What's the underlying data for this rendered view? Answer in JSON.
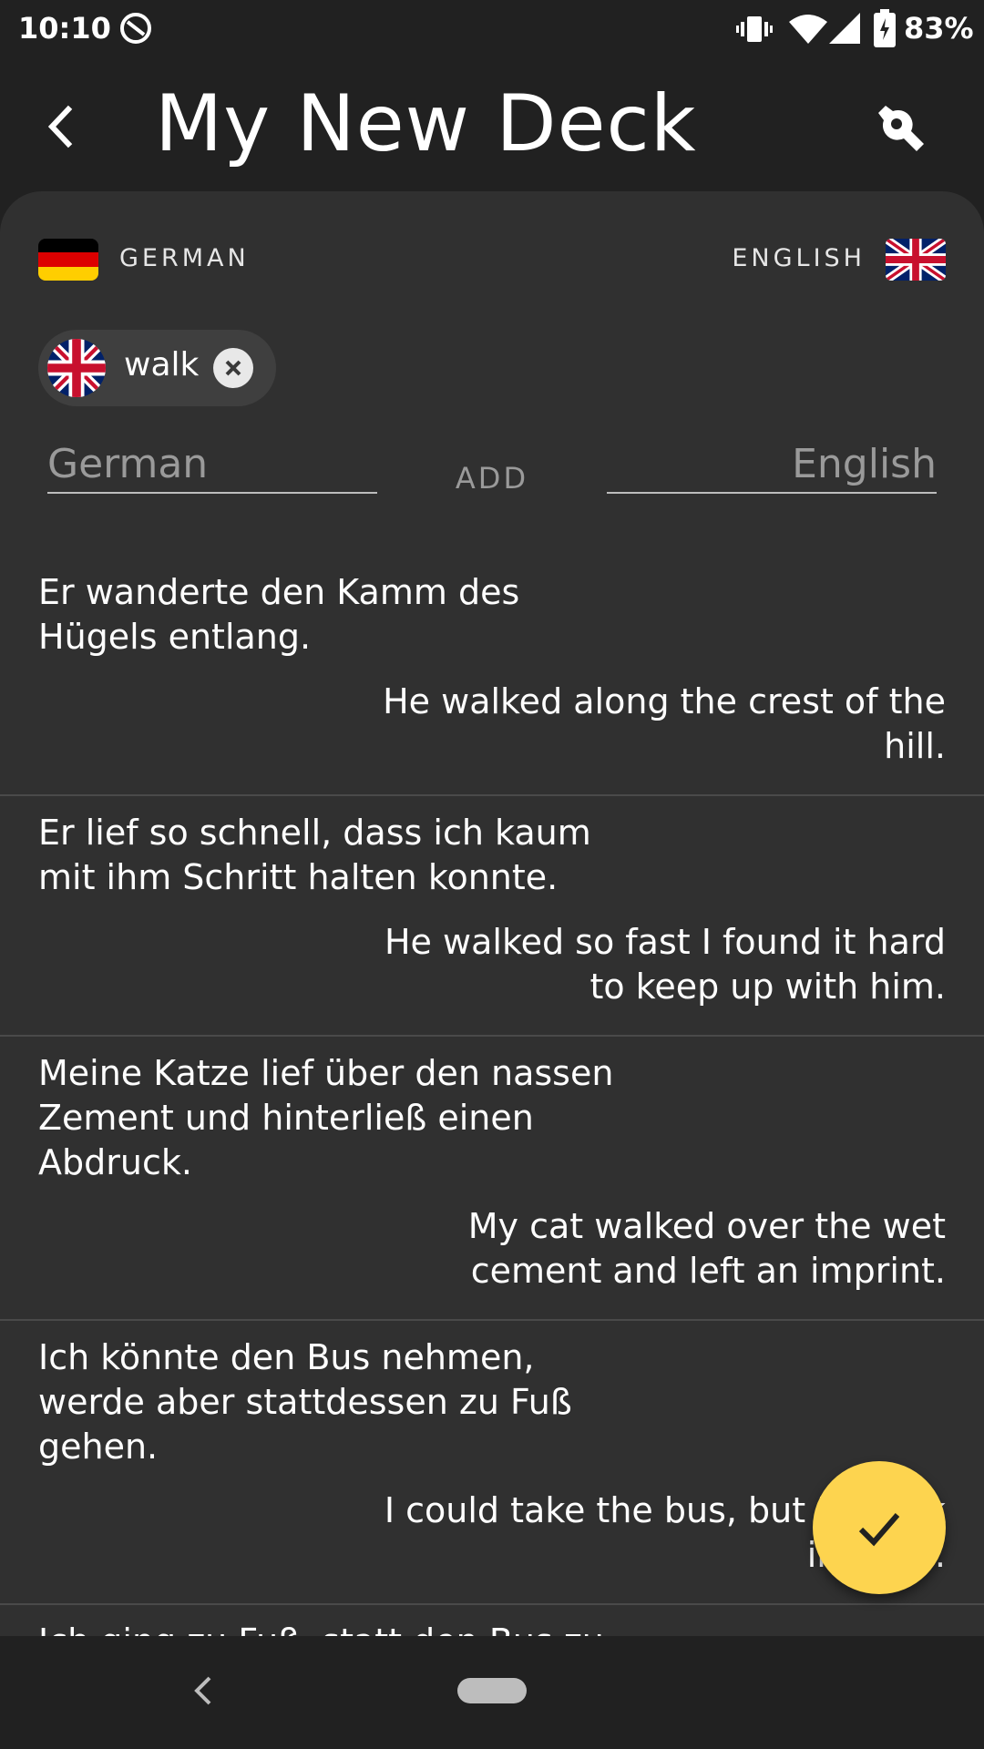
{
  "status_bar": {
    "time": "10:10",
    "battery": "83%",
    "icons": [
      "sync-icon",
      "vibrate-icon",
      "wifi-icon",
      "signal-icon",
      "battery-icon"
    ]
  },
  "header": {
    "title": "My New Deck",
    "back_icon": "back-arrow-icon",
    "settings_icon": "wrench-icon"
  },
  "languages": {
    "source": "GERMAN",
    "target": "ENGLISH"
  },
  "filter_chip": {
    "label": "walk",
    "flag": "uk-flag-icon",
    "close_icon": "close-icon"
  },
  "add_form": {
    "german_placeholder": "German",
    "german_value": "",
    "english_placeholder": "English",
    "english_value": "",
    "add_label": "ADD"
  },
  "sentences": [
    {
      "german": "Er wanderte den Kamm des Hügels entlang.",
      "english": "He walked along the crest of the hill."
    },
    {
      "german": "Er lief so schnell, dass ich kaum mit ihm Schritt halten konnte.",
      "english": "He walked so fast I found it hard to keep up with him."
    },
    {
      "german": "Meine Katze lief über den nassen Zement und hinterließ einen Abdruck.",
      "english": "My cat walked over the wet cement and left an imprint."
    },
    {
      "german": "Ich könnte den Bus nehmen, werde aber stattdessen zu Fuß gehen.",
      "english": "I could take the bus, but I'll walk instead."
    },
    {
      "german": "Ich ging zu Fuß, statt den Bus zu",
      "english": ""
    }
  ],
  "fab": {
    "icon": "checkmark-icon"
  },
  "colors": {
    "background": "#212121",
    "card": "#303030",
    "accent": "#fdd44f"
  }
}
